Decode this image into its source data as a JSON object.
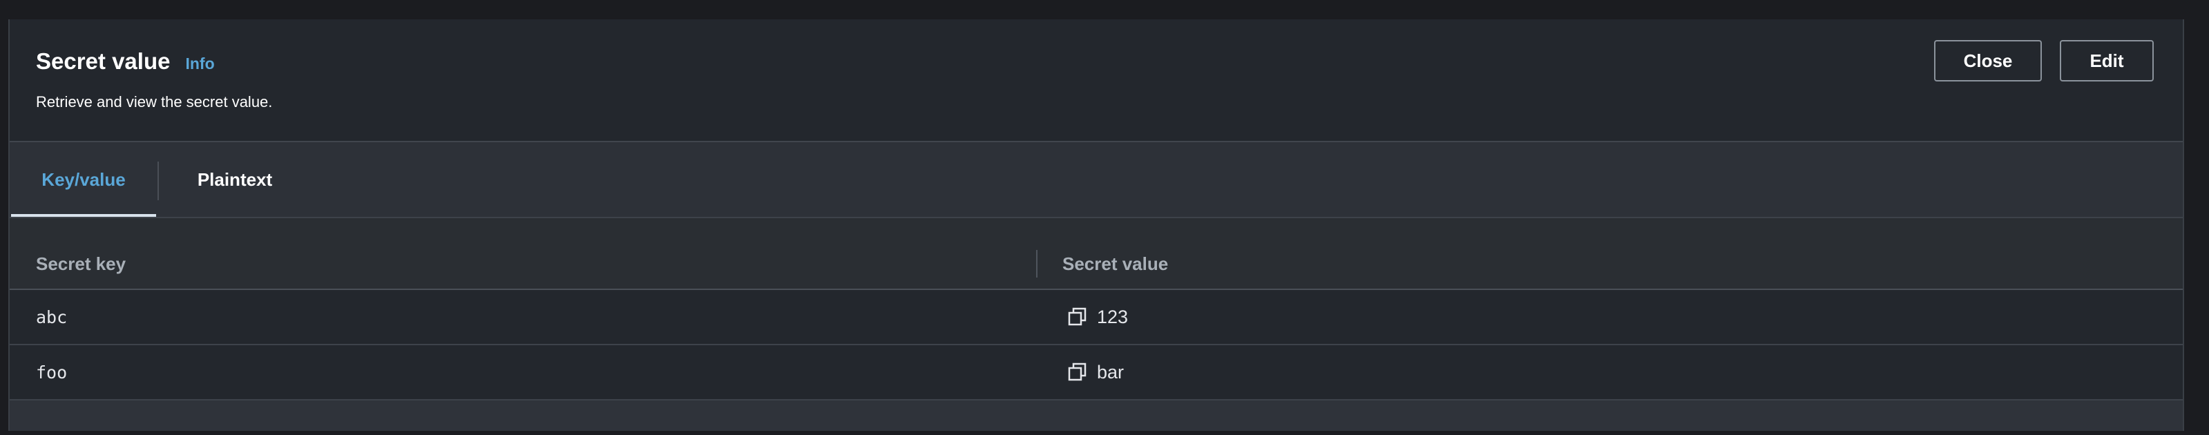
{
  "header": {
    "title": "Secret value",
    "info_label": "Info",
    "description": "Retrieve and view the secret value.",
    "close_label": "Close",
    "edit_label": "Edit"
  },
  "tabs": [
    {
      "label": "Key/value",
      "active": true
    },
    {
      "label": "Plaintext",
      "active": false
    }
  ],
  "table": {
    "columns": [
      "Secret key",
      "Secret value"
    ],
    "rows": [
      {
        "key": "abc",
        "value": "123"
      },
      {
        "key": "foo",
        "value": "bar"
      }
    ]
  },
  "colors": {
    "accent": "#5aa7d8",
    "background": "#2a2e33",
    "header_bg": "#23272d"
  },
  "icons": {
    "copy": "copy-icon"
  }
}
